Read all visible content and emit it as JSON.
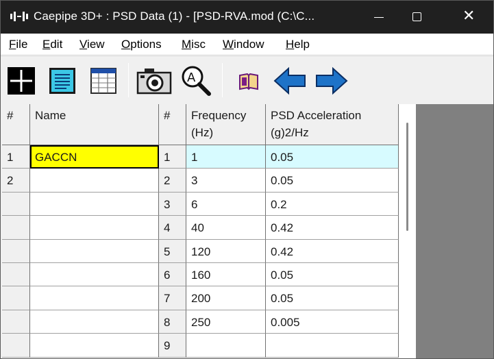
{
  "window": {
    "title": "Caepipe 3D+ : PSD Data  (1)  -  [PSD-RVA.mod (C:\\C...",
    "close_glyph": "✕"
  },
  "menu": {
    "items": [
      {
        "underline": "F",
        "rest": "ile"
      },
      {
        "underline": "E",
        "rest": "dit"
      },
      {
        "underline": "V",
        "rest": "iew"
      },
      {
        "underline": "O",
        "rest": "ptions"
      },
      {
        "underline": "M",
        "rest": "isc"
      },
      {
        "underline": "W",
        "rest": "indow"
      },
      {
        "underline": "H",
        "rest": "elp"
      }
    ]
  },
  "toolbar": {
    "icons": [
      "crosshair-icon",
      "document-icon",
      "table-icon",
      "camera-icon",
      "zoom-icon",
      "book-icon",
      "arrow-left-icon",
      "arrow-right-icon"
    ]
  },
  "left_table": {
    "headers": [
      "#",
      "Name"
    ],
    "rows": [
      {
        "num": "1",
        "name": "GACCN"
      },
      {
        "num": "2",
        "name": ""
      },
      {
        "num": "",
        "name": ""
      },
      {
        "num": "",
        "name": ""
      },
      {
        "num": "",
        "name": ""
      },
      {
        "num": "",
        "name": ""
      },
      {
        "num": "",
        "name": ""
      },
      {
        "num": "",
        "name": ""
      },
      {
        "num": "",
        "name": ""
      }
    ]
  },
  "right_table": {
    "headers": [
      "#",
      "Frequency\n(Hz)",
      "PSD Acceleration\n(g)2/Hz"
    ],
    "rows": [
      {
        "num": "1",
        "freq": "1",
        "psd": "0.05"
      },
      {
        "num": "2",
        "freq": "3",
        "psd": "0.05"
      },
      {
        "num": "3",
        "freq": "6",
        "psd": "0.2"
      },
      {
        "num": "4",
        "freq": "40",
        "psd": "0.42"
      },
      {
        "num": "5",
        "freq": "120",
        "psd": "0.42"
      },
      {
        "num": "6",
        "freq": "160",
        "psd": "0.05"
      },
      {
        "num": "7",
        "freq": "200",
        "psd": "0.05"
      },
      {
        "num": "8",
        "freq": "250",
        "psd": "0.005"
      },
      {
        "num": "9",
        "freq": "",
        "psd": ""
      }
    ]
  },
  "colors": {
    "selected_name_bg": "#ffff00",
    "active_row_bg": "#d7fbff",
    "arrow_blue": "#1e73c8"
  }
}
